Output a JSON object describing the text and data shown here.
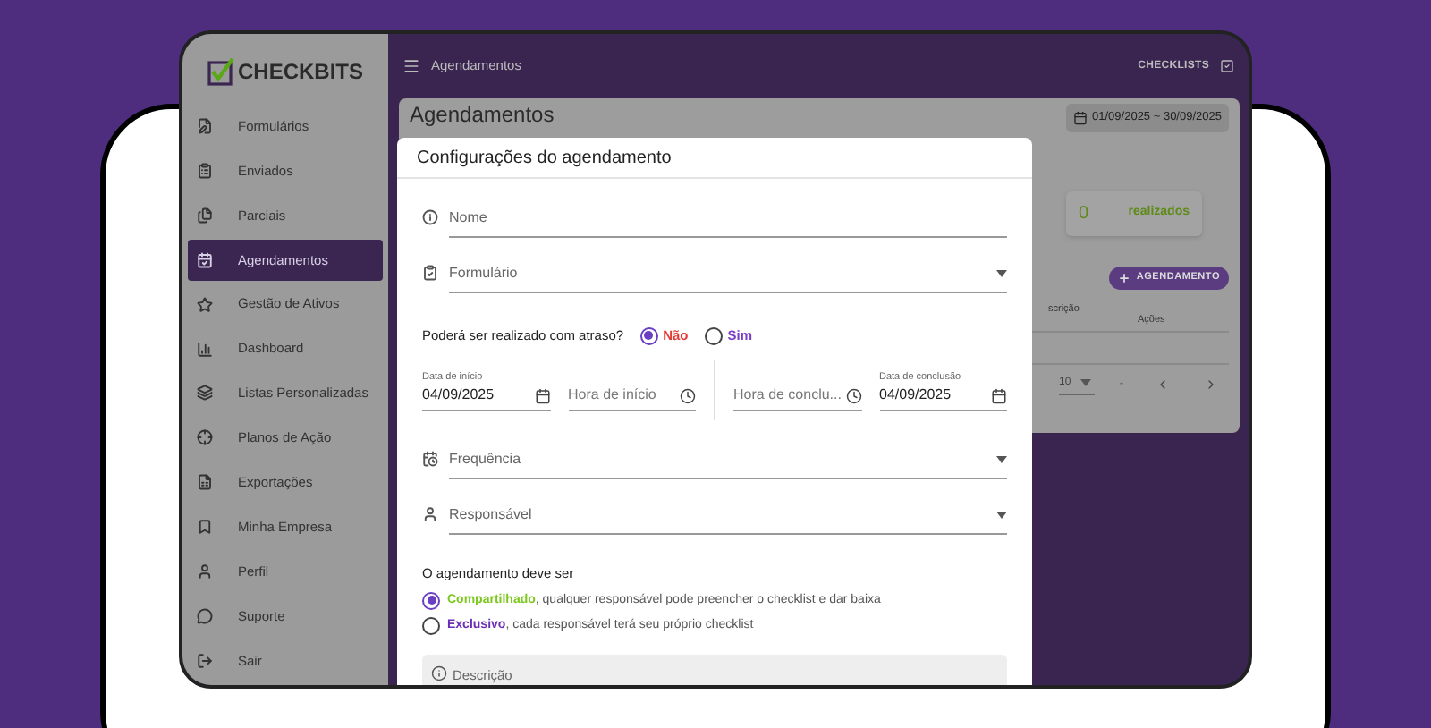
{
  "topbar": {
    "title": "Agendamentos",
    "link": "CHECKLISTS"
  },
  "logo": {
    "text": "CHECKBITS"
  },
  "sidebar": {
    "items": [
      {
        "label": "Formulários",
        "selected": false
      },
      {
        "label": "Enviados",
        "selected": false
      },
      {
        "label": "Parciais",
        "selected": false
      },
      {
        "label": "Agendamentos",
        "selected": true
      },
      {
        "label": "Gestão de Ativos",
        "selected": false
      },
      {
        "label": "Dashboard",
        "selected": false
      },
      {
        "label": "Listas Personalizadas",
        "selected": false
      },
      {
        "label": "Planos de Ação",
        "selected": false
      },
      {
        "label": "Exportações",
        "selected": false
      },
      {
        "label": "Minha Empresa",
        "selected": false
      },
      {
        "label": "Perfil",
        "selected": false
      },
      {
        "label": "Suporte",
        "selected": false
      },
      {
        "label": "Sair",
        "selected": false
      }
    ]
  },
  "page": {
    "title": "Agendamentos",
    "date_range": "01/09/2025 ~ 30/09/2025",
    "stat": {
      "value": "0",
      "label": "realizados"
    },
    "add_button": "AGENDAMENTO",
    "table": {
      "columns": [
        "scrição",
        "Ações"
      ]
    },
    "pagination": {
      "rows_per_page": "10",
      "range": "-"
    }
  },
  "dialog": {
    "title": "Configurações do agendamento",
    "top_fields": [
      {
        "kind": "text",
        "label": "Nome"
      },
      {
        "kind": "select",
        "label": "Formulário"
      }
    ],
    "late": {
      "question": "Poderá ser realizado com atraso?",
      "options": [
        {
          "label": "Não",
          "selected": true,
          "color": "#e53935"
        },
        {
          "label": "Sim",
          "selected": false,
          "color": "#7b3fc4"
        }
      ]
    },
    "schedule": [
      {
        "kind": "date",
        "label": "Data de início",
        "value": "04/09/2025"
      },
      {
        "kind": "time",
        "placeholder": "Hora de início"
      },
      {
        "kind": "time",
        "placeholder": "Hora de conclu..."
      },
      {
        "kind": "date",
        "label": "Data de conclusão",
        "value": "04/09/2025"
      }
    ],
    "bottom_fields": [
      {
        "kind": "select",
        "label": "Frequência"
      },
      {
        "kind": "select",
        "label": "Responsável"
      }
    ],
    "sharing": {
      "title": "O agendamento deve ser",
      "options": [
        {
          "name": "Compartilhado",
          "description": ", qualquer responsável pode preencher o checklist e dar baixa",
          "selected": true,
          "color": "#7cc81f"
        },
        {
          "name": "Exclusivo",
          "description": ", cada responsável terá seu próprio checklist",
          "selected": false,
          "color": "#6a2fb5"
        }
      ]
    },
    "description": {
      "placeholder": "Descrição"
    }
  }
}
